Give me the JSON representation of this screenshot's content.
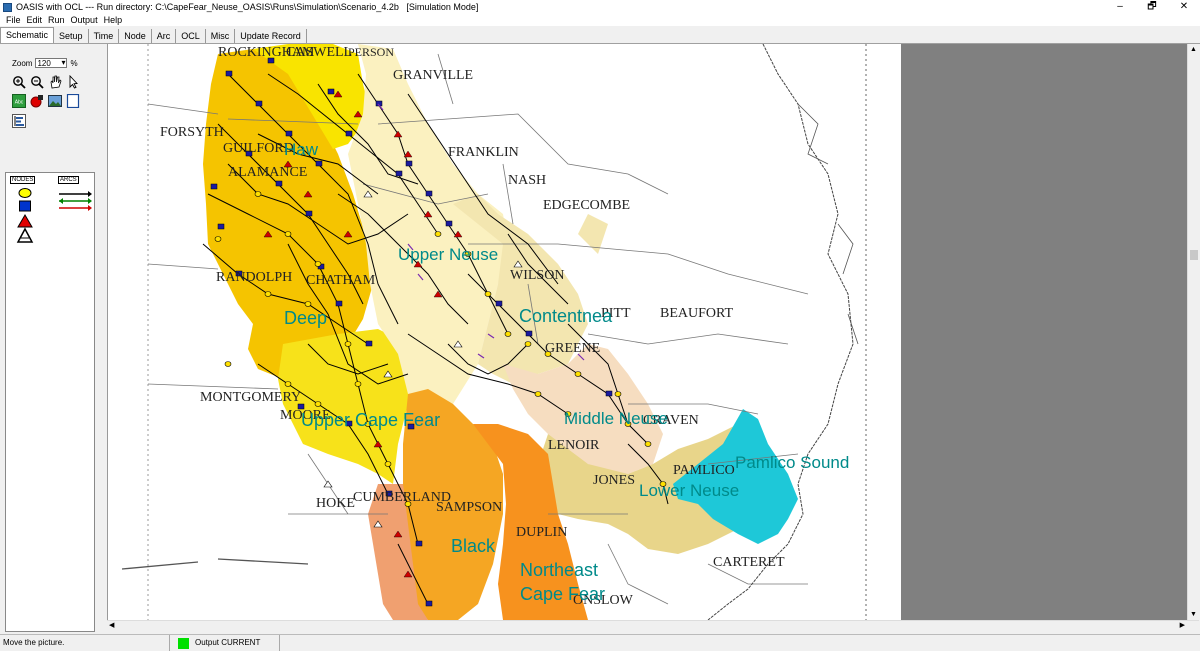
{
  "window": {
    "title": "OASIS with OCL --- Run directory: C:\\CapeFear_Neuse_OASIS\\Runs\\Simulation\\Scenario_4.2b   [Simulation Mode]",
    "controls": [
      "–",
      "🗗",
      "✕"
    ]
  },
  "menu": [
    "File",
    "Edit",
    "Run",
    "Output",
    "Help"
  ],
  "tabs": [
    "Schematic",
    "Setup",
    "Time",
    "Node",
    "Arc",
    "OCL",
    "Misc",
    "Update Record"
  ],
  "active_tab": "Schematic",
  "toolbar": {
    "zoom_label": "Zoom",
    "zoom_value": "120",
    "zoom_unit": "%"
  },
  "legend": {
    "nodes_label": "NODES",
    "arcs_label": "ARCS"
  },
  "map": {
    "basins": [
      "Deep",
      "Haw",
      "Upper Neuse",
      "Contentnea",
      "Middle Neuse",
      "Lower Neuse",
      "Pamlico Sound",
      "Upper Cape Fear",
      "Black",
      "Northeast",
      "Cape Fear"
    ],
    "counties": [
      "ROCKINGHAM",
      "CASWELL",
      "PERSON",
      "GRANVILLE",
      "FORSYTH",
      "GUILFORD",
      "FRANKLIN",
      "NASH",
      "ALAMANCE",
      "EDGECOMBE",
      "RANDOLPH",
      "CHATHAM",
      "WILSON",
      "PITT",
      "BEAUFORT",
      "GREENE",
      "MONTGOMERY",
      "MOORE",
      "LENOIR",
      "CRAVEN",
      "JONES",
      "PAMLICO",
      "HOKE",
      "CUMBERLAND",
      "SAMPSON",
      "DUPLIN",
      "ONSLOW",
      "CARTERET"
    ],
    "colors": {
      "deep": "#f5c400",
      "upper_cape_fear": "#f7e21a",
      "haw": "#f9e400",
      "upper_neuse": "#fbf1c0",
      "contentnea": "#f3e6b0",
      "middle_neuse": "#f6ddc0",
      "lower_neuse": "#e8d58a",
      "pamlico_sound": "#1ec8d8",
      "black": "#f5a623",
      "northeast_cape_fear": "#f7921e",
      "lower_cape_fear": "#f0a070",
      "basin_label": "#008a8a"
    }
  },
  "status": {
    "message": "Move the picture.",
    "output_label": "Output CURRENT",
    "output_color": "#00e000"
  }
}
